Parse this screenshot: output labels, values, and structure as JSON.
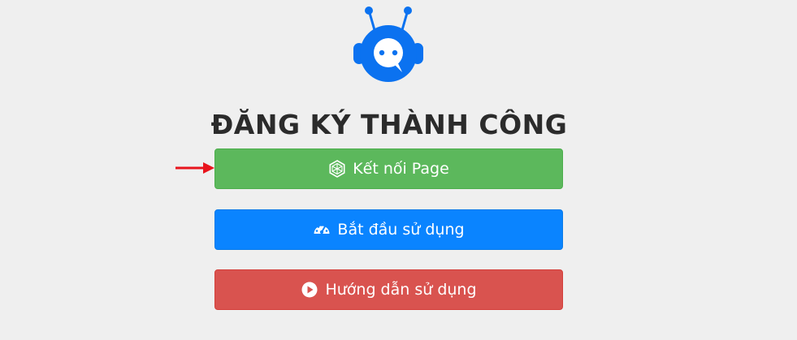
{
  "header": {
    "logo_icon": "chat-robot-logo-icon",
    "title": "ĐĂNG KÝ THÀNH CÔNG"
  },
  "annotation": {
    "arrow_icon": "red-arrow-icon",
    "arrow_color": "#e8141c"
  },
  "actions": [
    {
      "label": "Kết nối Page",
      "icon": "polygon-network-icon",
      "color": "#5cb85c"
    },
    {
      "label": "Bắt đầu sử dụng",
      "icon": "dashboard-gauge-icon",
      "color": "#0a84ff"
    },
    {
      "label": "Hướng dẫn sử dụng",
      "icon": "play-circle-icon",
      "color": "#d9534f"
    }
  ],
  "colors": {
    "background": "#efefef",
    "logo_blue": "#0b72f0",
    "title_text": "#2b2b2b"
  }
}
